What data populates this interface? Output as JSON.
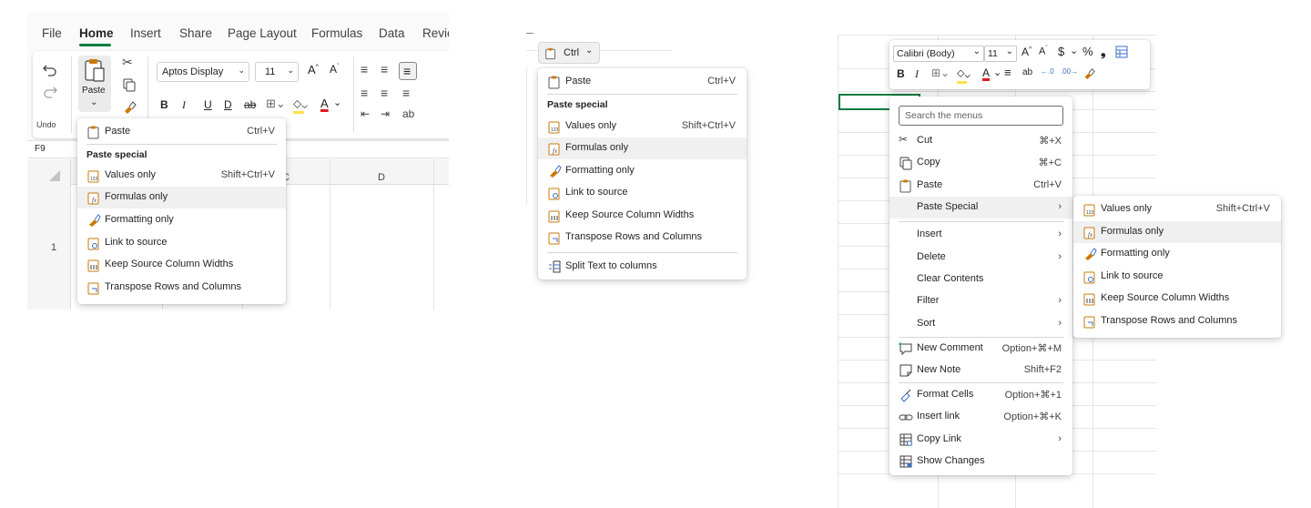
{
  "panel1": {
    "tabs": [
      "File",
      "Home",
      "Insert",
      "Share",
      "Page Layout",
      "Formulas",
      "Data",
      "Revie"
    ],
    "active_tab": "Home",
    "paste_label": "Paste",
    "undo_group_label": "Undo",
    "font_name": "Aptos Display",
    "font_size": "11",
    "name_box": "F9",
    "column_header_c_fragment": "C",
    "column_header_d": "D",
    "row_number": "1",
    "menu": {
      "paste": {
        "label": "Paste",
        "shortcut": "Ctrl+V"
      },
      "section": "Paste special",
      "items": [
        {
          "label": "Values only",
          "shortcut": "Shift+Ctrl+V",
          "icon": "values-only-icon"
        },
        {
          "label": "Formulas only",
          "shortcut": "",
          "icon": "formulas-only-icon",
          "highlighted": true
        },
        {
          "label": "Formatting only",
          "shortcut": "",
          "icon": "formatting-only-icon"
        },
        {
          "label": "Link to source",
          "shortcut": "",
          "icon": "link-to-source-icon"
        },
        {
          "label": "Keep Source Column Widths",
          "shortcut": "",
          "icon": "keep-widths-icon"
        },
        {
          "label": "Transpose Rows and Columns",
          "shortcut": "",
          "icon": "transpose-icon"
        }
      ]
    }
  },
  "panel2": {
    "ctrl_button": "Ctrl",
    "menu": {
      "paste": {
        "label": "Paste",
        "shortcut": "Ctrl+V"
      },
      "section": "Paste special",
      "items": [
        {
          "label": "Values only",
          "shortcut": "Shift+Ctrl+V"
        },
        {
          "label": "Formulas only",
          "shortcut": "",
          "highlighted": true
        },
        {
          "label": "Formatting only",
          "shortcut": ""
        },
        {
          "label": "Link to source",
          "shortcut": ""
        },
        {
          "label": "Keep Source Column Widths",
          "shortcut": ""
        },
        {
          "label": "Transpose Rows and Columns",
          "shortcut": ""
        }
      ],
      "split_text": "Split Text to columns"
    }
  },
  "panel3": {
    "toolbar": {
      "font_name": "Calibri (Body)",
      "font_size": "11"
    },
    "search_placeholder": "Search the menus",
    "menu_items": [
      {
        "label": "Cut",
        "shortcut": "⌘+X",
        "icon": "cut-icon"
      },
      {
        "label": "Copy",
        "shortcut": "⌘+C",
        "icon": "copy-icon"
      },
      {
        "label": "Paste",
        "shortcut": "Ctrl+V",
        "icon": "paste-icon"
      },
      {
        "label": "Paste Special",
        "shortcut": "",
        "submenu": true,
        "highlighted": true
      },
      {
        "label": "Insert",
        "shortcut": "",
        "submenu": true
      },
      {
        "label": "Delete",
        "shortcut": "",
        "submenu": true
      },
      {
        "label": "Clear Contents",
        "shortcut": ""
      },
      {
        "label": "Filter",
        "shortcut": "",
        "submenu": true
      },
      {
        "label": "Sort",
        "shortcut": "",
        "submenu": true
      },
      {
        "label": "New Comment",
        "shortcut": "Option+⌘+M",
        "icon": "new-comment-icon"
      },
      {
        "label": "New Note",
        "shortcut": "Shift+F2",
        "icon": "new-note-icon"
      },
      {
        "label": "Format Cells",
        "shortcut": "Option+⌘+1",
        "icon": "format-cells-icon"
      },
      {
        "label": "Insert link",
        "shortcut": "Option+⌘+K",
        "icon": "insert-link-icon"
      },
      {
        "label": "Copy Link",
        "shortcut": "",
        "submenu": true,
        "icon": "copy-link-icon"
      },
      {
        "label": "Show Changes",
        "shortcut": "",
        "icon": "show-changes-icon"
      }
    ],
    "submenu": [
      {
        "label": "Values only",
        "shortcut": "Shift+Ctrl+V"
      },
      {
        "label": "Formulas only",
        "shortcut": "",
        "highlighted": true
      },
      {
        "label": "Formatting only",
        "shortcut": ""
      },
      {
        "label": "Link to source",
        "shortcut": ""
      },
      {
        "label": "Keep Source Column Widths",
        "shortcut": ""
      },
      {
        "label": "Transpose Rows and Columns",
        "shortcut": ""
      }
    ]
  },
  "colors": {
    "excel_green": "#107c41",
    "clipboard_orange": "#c97a0a",
    "highlight": "#f0f0f0",
    "font_red": "#e01b1b",
    "fill_yellow": "#ffe14d"
  }
}
